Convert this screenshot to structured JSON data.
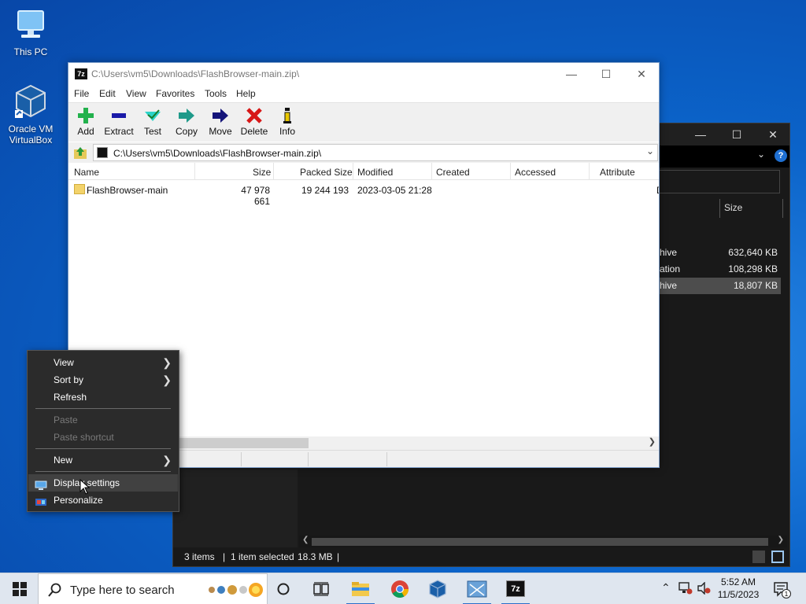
{
  "desktop": {
    "icons": [
      {
        "label": "This PC",
        "icon": "this-pc-icon"
      },
      {
        "label": "Oracle VM VirtualBox",
        "icon": "virtualbox-icon"
      }
    ]
  },
  "bg_explorer": {
    "column_size": "Size",
    "rows": [
      {
        "name": "hive",
        "size": "632,640 KB"
      },
      {
        "name": "ation",
        "size": "108,298 KB"
      },
      {
        "name": "hive",
        "size": "18,807 KB"
      }
    ],
    "status": {
      "items": "3 items",
      "selected": "1 item selected",
      "sel_size": "18.3 MB"
    }
  },
  "zip": {
    "title": "C:\\Users\\vm5\\Downloads\\FlashBrowser-main.zip\\",
    "menu": [
      "File",
      "Edit",
      "View",
      "Favorites",
      "Tools",
      "Help"
    ],
    "toolbar": [
      "Add",
      "Extract",
      "Test",
      "Copy",
      "Move",
      "Delete",
      "Info"
    ],
    "address": "C:\\Users\\vm5\\Downloads\\FlashBrowser-main.zip\\",
    "columns": [
      "Name",
      "Size",
      "Packed Size",
      "Modified",
      "Created",
      "Accessed",
      "Attribute"
    ],
    "rows": [
      {
        "name": "FlashBrowser-main",
        "size": "47 978 661",
        "packed": "19 244 193",
        "modified": "2023-03-05 21:28",
        "created": "",
        "accessed": "",
        "attr": "D"
      }
    ]
  },
  "context_menu": {
    "items": [
      {
        "label": "View",
        "submenu": true,
        "disabled": false
      },
      {
        "label": "Sort by",
        "submenu": true,
        "disabled": false
      },
      {
        "label": "Refresh",
        "submenu": false,
        "disabled": false
      },
      {
        "label": "Paste",
        "submenu": false,
        "disabled": true
      },
      {
        "label": "Paste shortcut",
        "submenu": false,
        "disabled": true
      },
      {
        "label": "New",
        "submenu": true,
        "disabled": false
      },
      {
        "label": "Display settings",
        "submenu": false,
        "disabled": false
      },
      {
        "label": "Personalize",
        "submenu": false,
        "disabled": false
      }
    ]
  },
  "taskbar": {
    "search_placeholder": "Type here to search",
    "time": "5:52 AM",
    "date": "11/5/2023",
    "notification_count": "1"
  }
}
